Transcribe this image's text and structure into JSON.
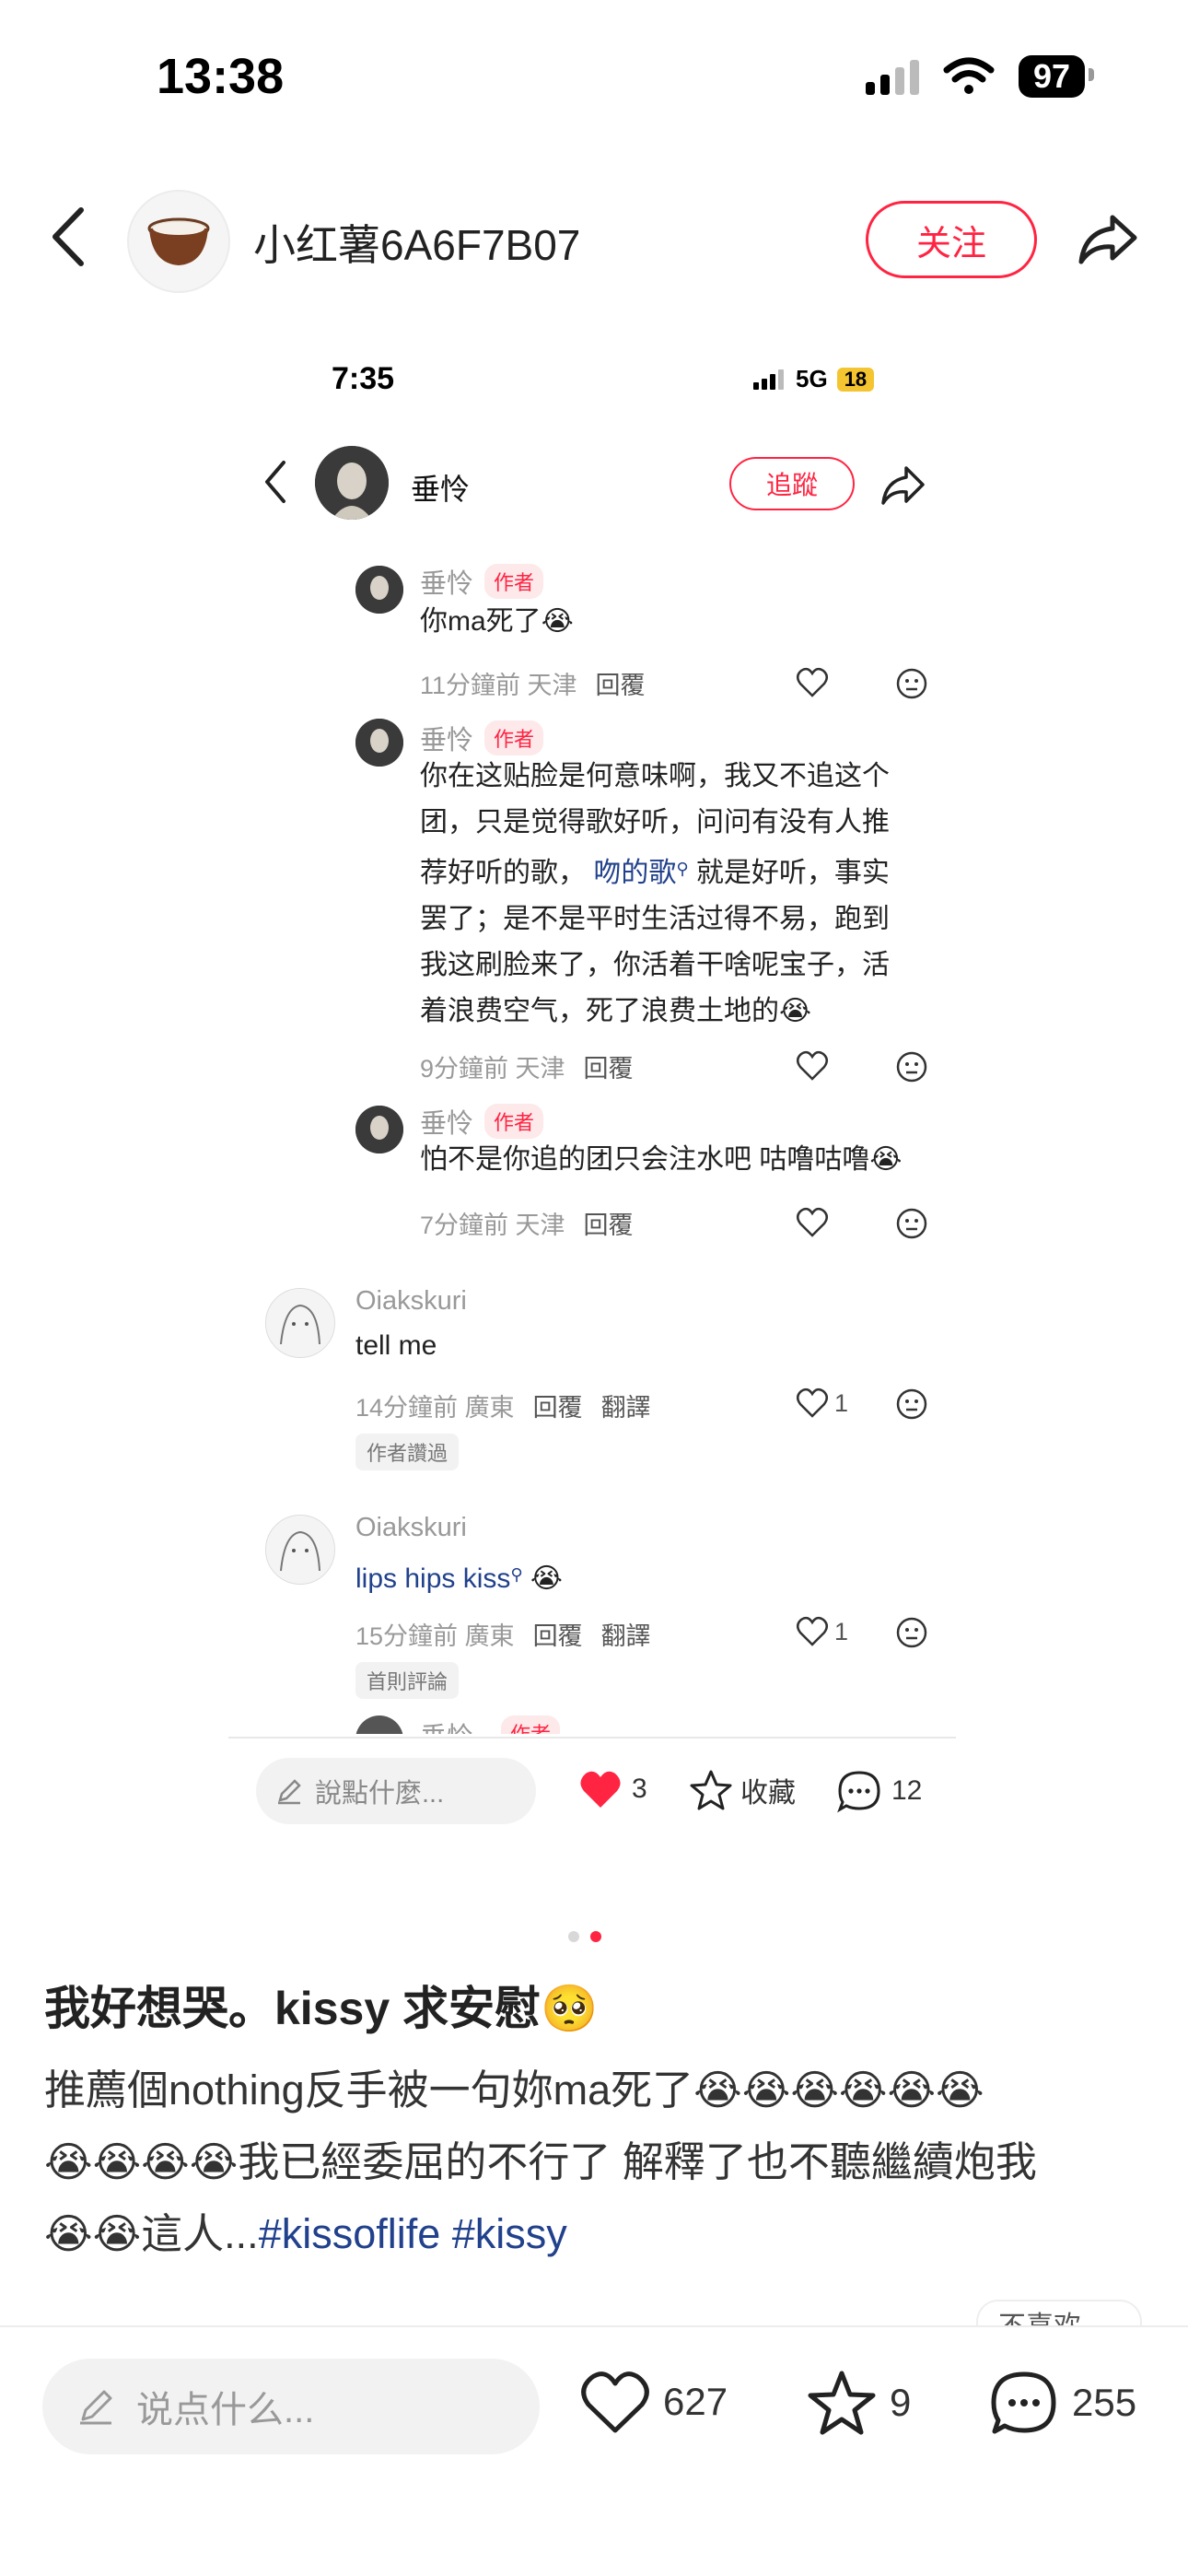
{
  "status": {
    "time": "13:38",
    "battery": "97"
  },
  "header": {
    "username": "小红薯6A6F7B07",
    "follow_label": "关注"
  },
  "inner": {
    "status_time": "7:35",
    "network": "5G",
    "battery": "18",
    "author": "垂怜",
    "follow_label": "追蹤",
    "author_tag": "作者",
    "comments": [
      {
        "user": "垂怜",
        "text": "你ma死了",
        "time": "11分鐘前",
        "loc": "天津",
        "reply": "回覆"
      },
      {
        "user": "垂怜",
        "text_lines": [
          "你在这贴脸是何意味啊，我又不追这个",
          "团，只是觉得歌好听，问问有没有人推",
          "荐好听的歌，"
        ],
        "link": "吻的歌",
        "text_after": "就是好听，事实",
        "text_lines2": [
          "罢了；是不是平时生活过得不易，跑到",
          "我这刷脸来了，你活着干啥呢宝子，活",
          "着浪费空气，死了浪费土地的"
        ],
        "time": "9分鐘前",
        "loc": "天津",
        "reply": "回覆"
      },
      {
        "user": "垂怜",
        "text": "怕不是你追的团只会注水吧 咕噜咕噜",
        "time": "7分鐘前",
        "loc": "天津",
        "reply": "回覆"
      },
      {
        "user": "Oiakskuri",
        "text": "tell me",
        "time": "14分鐘前",
        "loc": "廣東",
        "reply": "回覆",
        "translate": "翻譯",
        "likes": "1",
        "tag": "作者讚過"
      },
      {
        "user": "Oiakskuri",
        "link": "lips hips kiss",
        "time": "15分鐘前",
        "loc": "廣東",
        "reply": "回覆",
        "translate": "翻譯",
        "likes": "1",
        "tag": "首則評論"
      }
    ],
    "partial_user": "垂怜",
    "partial_tag": "作者",
    "input_placeholder": "說點什麼...",
    "likes": "3",
    "collect_label": "收藏",
    "comment_count": "12"
  },
  "post": {
    "title": "我好想哭。kissy 求安慰",
    "body_line1": "推薦個nothing反手被一句妳ma死了",
    "body_line2": "我已經委屈的不行了 解釋了也不聽繼續炮我",
    "body_line3": "這人...",
    "hashtags": "#kissoflife #kissy",
    "dislike_label": "不喜欢"
  },
  "bottom": {
    "input_placeholder": "说点什么...",
    "likes": "627",
    "stars": "9",
    "comments": "255"
  },
  "colors": {
    "accent": "#ff2442",
    "link": "#21418c"
  }
}
